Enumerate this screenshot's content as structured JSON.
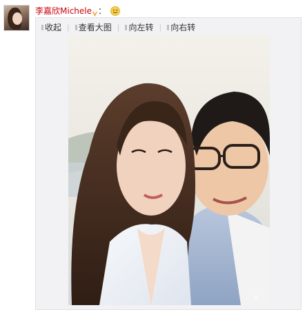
{
  "post": {
    "author": "李嘉欣Michele",
    "colon": "：",
    "avatar_icon": "avatar-photo",
    "vip_icon": "vip-v-icon",
    "emoji_icon": "smile-emoji-icon"
  },
  "media": {
    "toolbar": [
      {
        "label": "收起",
        "icon": "collapse-icon"
      },
      {
        "label": "查看大图",
        "icon": "view-large-icon"
      },
      {
        "label": "向左转",
        "icon": "rotate-left-icon"
      },
      {
        "label": "向右转",
        "icon": "rotate-right-icon"
      }
    ],
    "separator": "|",
    "photo_alt": "selfie-photo"
  },
  "colors": {
    "username": "#c7000b",
    "box_background": "#f2f2f5",
    "box_border": "#dfe0e3",
    "vip_orange": "#f89a1c"
  }
}
